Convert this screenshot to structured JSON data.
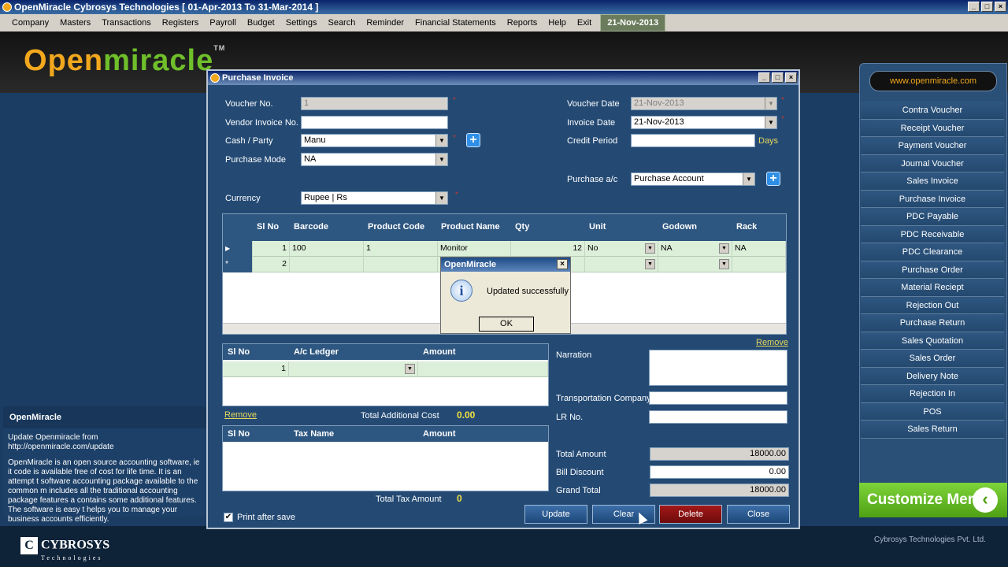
{
  "app": {
    "title": "OpenMiracle Cybrosys Technologies [ 01-Apr-2013 To 31-Mar-2014 ]",
    "window_buttons": [
      "_",
      "□",
      "×"
    ]
  },
  "menubar": {
    "items": [
      "Company",
      "Masters",
      "Transactions",
      "Registers",
      "Payroll",
      "Budget",
      "Settings",
      "Search",
      "Reminder",
      "Financial Statements",
      "Reports",
      "Help",
      "Exit"
    ],
    "date": "21-Nov-2013"
  },
  "logo": {
    "o": "O",
    "text_a": "pen",
    "text_b": "miracle",
    "tm": "TM"
  },
  "left_panel": {
    "header": "OpenMiracle",
    "update_line": "Update Openmiracle from http://openmiracle.com/update",
    "description": "OpenMiracle is an open source accounting software, ie it code is available free of cost for life time. It is an attempt t software accounting package available to the common m includes all the traditional accounting package features a contains some additional features. The software is easy t helps you to manage your business accounts efficiently."
  },
  "footer": {
    "company_mark": "C",
    "company": "CYBROSYS",
    "company_sub": "Technologies",
    "right_text": "Cybrosys Technologies Pvt. Ltd."
  },
  "sidebar": {
    "website": "www.openmiracle.com",
    "items": [
      "Contra Voucher",
      "Receipt Voucher",
      "Payment Voucher",
      "Journal Voucher",
      "Sales Invoice",
      "Purchase Invoice",
      "PDC Payable",
      "PDC Receivable",
      "PDC Clearance",
      "Purchase Order",
      "Material Reciept",
      "Rejection Out",
      "Purchase Return",
      "Sales Quotation",
      "Sales Order",
      "Delivery Note",
      "Rejection In",
      "POS",
      "Sales Return"
    ],
    "customize": "Customize Menu",
    "customize_arrow": "‹"
  },
  "purchase_invoice": {
    "title": "Purchase Invoice",
    "voucher_no_label": "Voucher No.",
    "voucher_no": "1",
    "vendor_invoice_label": "Vendor Invoice No.",
    "vendor_invoice": "",
    "cash_party_label": "Cash / Party",
    "cash_party": "Manu",
    "purchase_mode_label": "Purchase Mode",
    "purchase_mode": "NA",
    "currency_label": "Currency",
    "currency": "Rupee | Rs",
    "voucher_date_label": "Voucher Date",
    "voucher_date": "21-Nov-2013",
    "invoice_date_label": "Invoice Date",
    "invoice_date": "21-Nov-2013",
    "credit_period_label": "Credit Period",
    "credit_period": "",
    "days_label": "Days",
    "purchase_ac_label": "Purchase a/c",
    "purchase_ac": "Purchase Account",
    "grid": {
      "headers": [
        "Sl No",
        "Barcode",
        "Product Code",
        "Product Name",
        "Qty",
        "Unit",
        "Godown",
        "Rack"
      ],
      "rows": [
        {
          "marker": "▶",
          "sl": "1",
          "barcode": "100",
          "code": "1",
          "name": "Monitor",
          "qty": "12",
          "unit": "No",
          "godown": "NA",
          "rack": "NA"
        },
        {
          "marker": "*",
          "sl": "2",
          "barcode": "",
          "code": "",
          "name": "",
          "qty": "",
          "unit": "",
          "godown": "",
          "rack": ""
        }
      ]
    },
    "remove_link": "Remove",
    "ledger_grid": {
      "headers": [
        "Sl No",
        "A/c Ledger",
        "Amount"
      ],
      "rows": [
        {
          "sl": "1",
          "ledger": "",
          "amount": ""
        }
      ]
    },
    "remove_link2": "Remove",
    "total_additional_cost_label": "Total Additional Cost",
    "total_additional_cost": "0.00",
    "tax_grid": {
      "headers": [
        "Sl No",
        "Tax Name",
        "Amount"
      ]
    },
    "total_tax_label": "Total Tax Amount",
    "total_tax": "0",
    "print_after_save": "Print after save",
    "narration_label": "Narration",
    "transport_label": "Transportation Company",
    "lr_label": "LR No.",
    "total_amount_label": "Total Amount",
    "total_amount": "18000.00",
    "bill_discount_label": "Bill Discount",
    "bill_discount": "0.00",
    "grand_total_label": "Grand Total",
    "grand_total": "18000.00",
    "buttons": {
      "update": "Update",
      "clear": "Clear",
      "delete": "Delete",
      "close": "Close"
    }
  },
  "message_box": {
    "title": "OpenMiracle",
    "text": "Updated successfully",
    "ok": "OK",
    "close": "×",
    "icon": "i"
  }
}
